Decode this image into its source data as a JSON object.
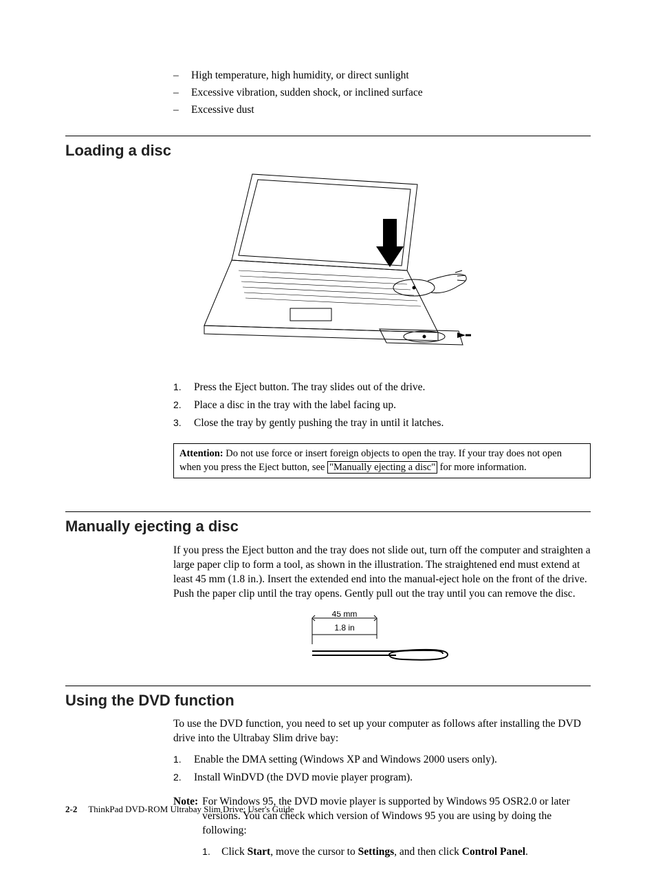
{
  "top_bullets": [
    "High temperature, high humidity, or direct sunlight",
    "Excessive vibration, sudden shock, or inclined surface",
    "Excessive dust"
  ],
  "section1": {
    "title": "Loading a disc",
    "steps": [
      "Press the Eject button. The tray slides out of the drive.",
      "Place a disc in the tray with the label facing up.",
      "Close the tray by gently pushing the tray in until it latches."
    ],
    "attention_label": "Attention:",
    "attention_pre": " Do not use force or insert foreign objects to open the tray. If your tray does not open when you press the Eject button, see ",
    "attention_link": "\"Manually ejecting a disc\"",
    "attention_post": " for more information."
  },
  "section2": {
    "title": "Manually ejecting a disc",
    "para": "If you press the Eject button and the tray does not slide out, turn off the computer and straighten a large paper clip to form a tool, as shown in the illustration. The straightened end must extend at least 45 mm (1.8 in.). Insert the extended end into the manual-eject hole on the front of the drive. Push the paper clip until the tray opens. Gently pull out the tray until you can remove the disc.",
    "dim_mm": "45 mm",
    "dim_in": "1.8 in"
  },
  "section3": {
    "title": "Using the DVD function",
    "intro": "To use the DVD function, you need to set up your computer as follows after installing the DVD drive into the Ultrabay Slim drive bay:",
    "steps": [
      "Enable the DMA setting (Windows XP and Windows 2000 users only).",
      "Install WinDVD (the DVD movie player program)."
    ],
    "note_label": "Note:",
    "note_text": " For Windows 95, the DVD movie player is supported by Windows 95 OSR2.0 or later versions. You can check which version of Windows 95 you are using by doing the following:",
    "note_step_pre": "Click ",
    "note_step_b1": "Start",
    "note_step_mid1": ", move the cursor to ",
    "note_step_b2": "Settings",
    "note_step_mid2": ", and then click ",
    "note_step_b3": "Control Panel",
    "note_step_post": "."
  },
  "footer": {
    "pagenum": "2-2",
    "title": "ThinkPad DVD-ROM Ultrabay Slim Drive: User's Guide"
  }
}
